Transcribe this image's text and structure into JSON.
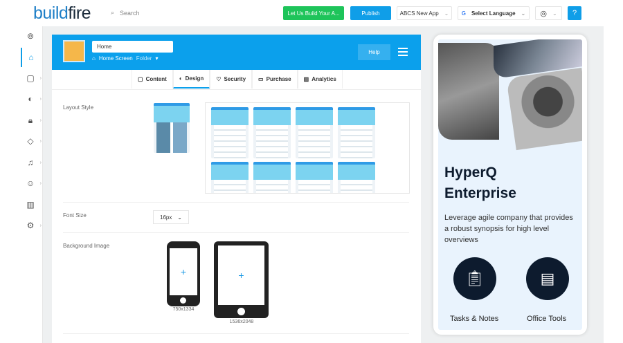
{
  "topbar": {
    "logo_a": "build",
    "logo_b": "fire",
    "search_placeholder": "Search",
    "cta": "Let Us Build Your A...",
    "publish": "Publish",
    "app_select": "ABCS New App",
    "language": "Select Language"
  },
  "colors": {
    "accent": "#0ba0ec",
    "green": "#1ec45a",
    "dark": "#0d1b2e"
  },
  "sidebar": {
    "icons": [
      "lifebuoy-icon",
      "home-icon",
      "pages-icon",
      "palette-icon",
      "lock-icon",
      "tag-icon",
      "bell-icon",
      "user-icon",
      "chart-icon",
      "gear-icon"
    ]
  },
  "header": {
    "title_value": "Home",
    "breadcrumb": "Home Screen",
    "type": "Folder",
    "help": "Help"
  },
  "tabs": [
    {
      "label": "Content",
      "icon": "▢"
    },
    {
      "label": "Design",
      "icon": "◐"
    },
    {
      "label": "Security",
      "icon": "♡"
    },
    {
      "label": "Purchase",
      "icon": "▭"
    },
    {
      "label": "Analytics",
      "icon": "▥"
    }
  ],
  "design": {
    "layout_label": "Layout Style",
    "font_label": "Font Size",
    "font_value": "16px",
    "bg_label": "Background Image",
    "phone_dim": "750x1334",
    "tablet_dim": "1536x2048"
  },
  "preview": {
    "title1": "HyperQ",
    "title2": "Enterprise",
    "desc": "Leverage agile company that provides a robust synopsis for high level overviews",
    "items": [
      {
        "label": "Tasks & Notes",
        "icon": "clipboard-icon"
      },
      {
        "label": "Office Tools",
        "icon": "document-icon"
      }
    ]
  }
}
